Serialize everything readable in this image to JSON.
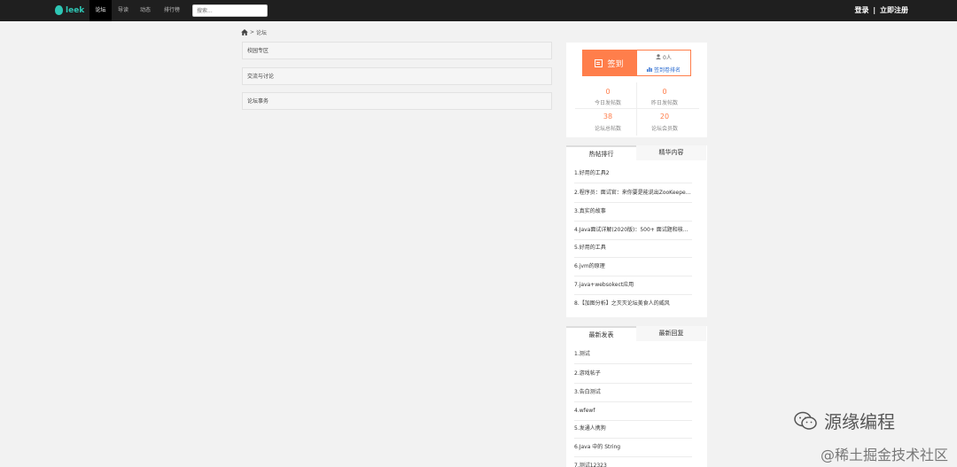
{
  "nav": {
    "logo": "leek",
    "items": [
      {
        "label": "论坛",
        "active": true
      },
      {
        "label": "导读",
        "active": false
      },
      {
        "label": "动态",
        "active": false
      },
      {
        "label": "排行榜",
        "active": false
      }
    ],
    "search_placeholder": "搜索...",
    "login": "登录",
    "sep": "|",
    "register": "立即注册"
  },
  "breadcrumb": {
    "sep": ">",
    "current": "论坛"
  },
  "forums": [
    "校园专区",
    "交流与讨论",
    "论坛事务"
  ],
  "sign": {
    "button": "签到",
    "count": "0人",
    "rank_link": "签到卷排名",
    "stats": [
      {
        "value": "0",
        "label": "今日发帖数"
      },
      {
        "value": "0",
        "label": "昨日发帖数"
      },
      {
        "value": "38",
        "label": "论坛总帖数"
      },
      {
        "value": "20",
        "label": "论坛会员数"
      }
    ]
  },
  "hot": {
    "tabs": [
      "热帖排行",
      "精华内容"
    ],
    "items": [
      "1.好用的工具2",
      "2.程序员：面试官：来你要是能说出ZooKeeper的原理我就录用你",
      "3.真实的故事",
      "4.Java面试详解(2020版)：500+ 面试题和核心知识点详解",
      "5.好用的工具",
      "6.jvm的原理",
      "7.java+websokect应用",
      "8.【加图分析】之灭灭论坛美食人的威风"
    ]
  },
  "latest": {
    "tabs": [
      "最新发表",
      "最新回复"
    ],
    "items": [
      "1.测试",
      "2.游戏帖子",
      "3.告白测试",
      "4.wfewf",
      "5.发通人携狗",
      "6.Java 中的 String",
      "7.测试12323"
    ]
  },
  "watermark": {
    "wechat": "源缘编程",
    "juejin": "@稀土掘金技术社区"
  }
}
